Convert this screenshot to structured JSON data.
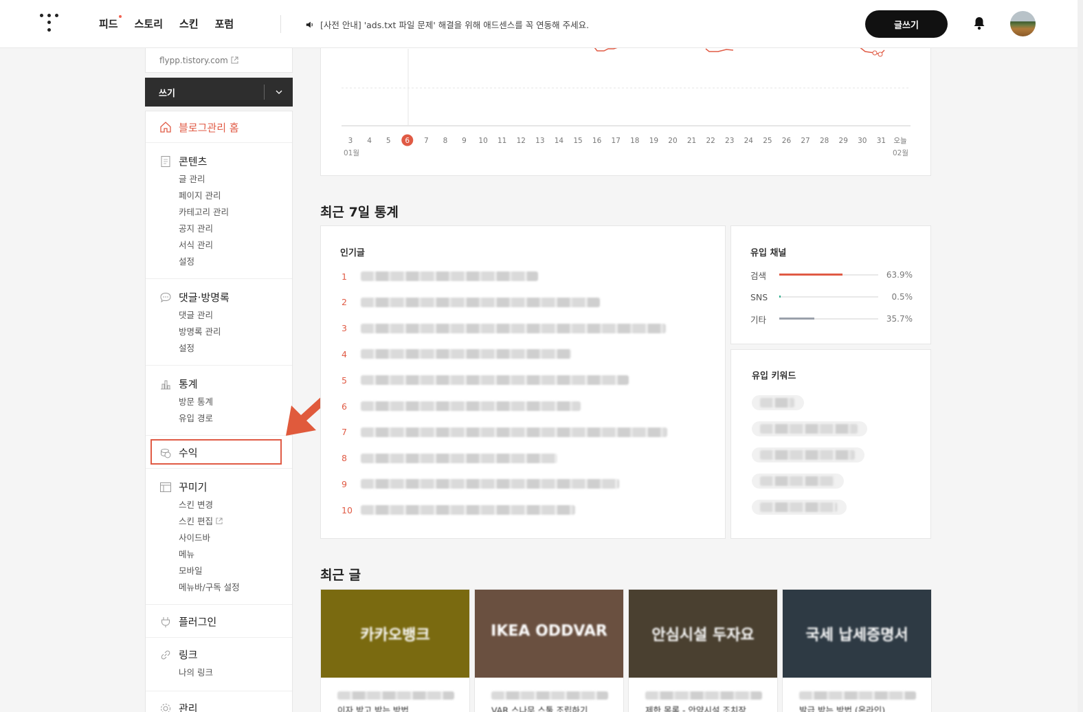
{
  "header": {
    "nav": [
      "피드",
      "스토리",
      "스킨",
      "포럼"
    ],
    "notice": "[사전 안내] 'ads.txt 파일 문제' 해결을 위해 애드센스를 꼭 연동해 주세요.",
    "write_button": "글쓰기"
  },
  "sidebar": {
    "blog_url": "flypp.tistory.com",
    "write_label": "쓰기",
    "home": "블로그관리 홈",
    "sections": [
      {
        "title": "콘텐츠",
        "icon": "document-icon",
        "items": [
          "글 관리",
          "페이지 관리",
          "카테고리 관리",
          "공지 관리",
          "서식 관리",
          "설정"
        ]
      },
      {
        "title": "댓글·방명록",
        "icon": "comment-icon",
        "items": [
          "댓글 관리",
          "방명록 관리",
          "설정"
        ]
      },
      {
        "title": "통계",
        "icon": "bar-chart-icon",
        "items": [
          "방문 통계",
          "유입 경로"
        ]
      },
      {
        "title": "수익",
        "icon": "coin-icon",
        "items": []
      },
      {
        "title": "꾸미기",
        "icon": "layout-icon",
        "items": [
          "스킨 변경",
          "스킨 편집",
          "사이드바",
          "메뉴",
          "모바일",
          "메뉴바/구독 설정"
        ]
      },
      {
        "title": "플러그인",
        "icon": "plug-icon",
        "items": []
      },
      {
        "title": "링크",
        "icon": "link-icon",
        "items": [
          "나의 링크"
        ]
      },
      {
        "title": "관리",
        "icon": "gear-icon",
        "items": []
      }
    ]
  },
  "chart": {
    "x_ticks": [
      "3",
      "4",
      "5",
      "6",
      "7",
      "8",
      "9",
      "10",
      "11",
      "12",
      "13",
      "14",
      "15",
      "16",
      "17",
      "18",
      "19",
      "20",
      "21",
      "22",
      "23",
      "24",
      "25",
      "26",
      "27",
      "28",
      "29",
      "30",
      "31",
      "오늘"
    ],
    "highlight_tick": "6",
    "month_start": "01월",
    "month_end": "02월"
  },
  "recent7": {
    "title": "최근 7일 통계",
    "popular_title": "인기글",
    "ranks": [
      "1",
      "2",
      "3",
      "4",
      "5",
      "6",
      "7",
      "8",
      "9",
      "10"
    ],
    "channel_title": "유입 채널",
    "channels": [
      {
        "label": "검색",
        "value": "63.9%",
        "fraction": 0.639,
        "color": "#e05a44"
      },
      {
        "label": "SNS",
        "value": "0.5%",
        "fraction": 0.005,
        "color": "#2fae8e"
      },
      {
        "label": "기타",
        "value": "35.7%",
        "fraction": 0.357,
        "color": "#9aa0aa"
      }
    ],
    "keyword_title": "유입 키워드"
  },
  "recent_posts": {
    "title": "최근 글",
    "thumbs": [
      {
        "line1": "카카오뱅크",
        "line2": "",
        "caption": "이자 받고 받는 방법",
        "color": "#7a6a10"
      },
      {
        "line1": "IKEA ODDVAR",
        "line2": "",
        "caption": "VAR 스나무 스툴 조립하기",
        "color": "#6a5040"
      },
      {
        "line1": "안심시설 두자요",
        "line2": "",
        "caption": "제한 목록 - 안약시설 조치장",
        "color": "#4a4030"
      },
      {
        "line1": "국세 납세증명서",
        "line2": "",
        "caption": "발급 받는 방법 (온라인)",
        "color": "#2e3a44"
      }
    ]
  }
}
